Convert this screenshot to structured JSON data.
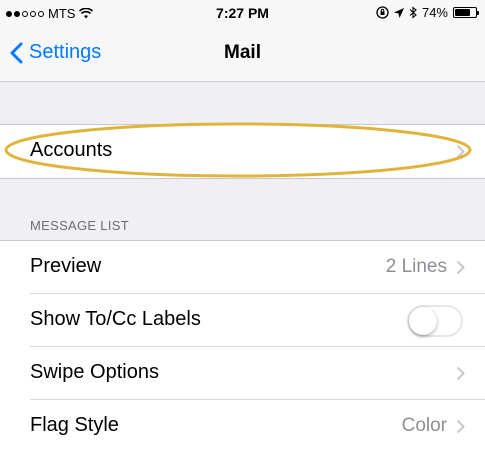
{
  "status_bar": {
    "carrier": "MTS",
    "time": "7:27 PM",
    "battery_percent": "74%",
    "battery_level": 0.74,
    "signal_bars_filled": 2,
    "signal_bars_total": 5,
    "icons": [
      "wifi-icon",
      "lock-rotation-icon",
      "location-icon",
      "bluetooth-icon",
      "battery-icon"
    ]
  },
  "nav": {
    "back_label": "Settings",
    "title": "Mail"
  },
  "accounts": {
    "label": "Accounts"
  },
  "message_list": {
    "header": "MESSAGE LIST",
    "rows": [
      {
        "label": "Preview",
        "value": "2 Lines",
        "has_chevron": true
      },
      {
        "label": "Show To/Cc Labels",
        "toggle": false
      },
      {
        "label": "Swipe Options",
        "value": "",
        "has_chevron": true
      },
      {
        "label": "Flag Style",
        "value": "Color",
        "has_chevron": true
      }
    ]
  },
  "colors": {
    "accent": "#007aff",
    "background": "#efeff4",
    "highlight": "#e0b43c"
  }
}
